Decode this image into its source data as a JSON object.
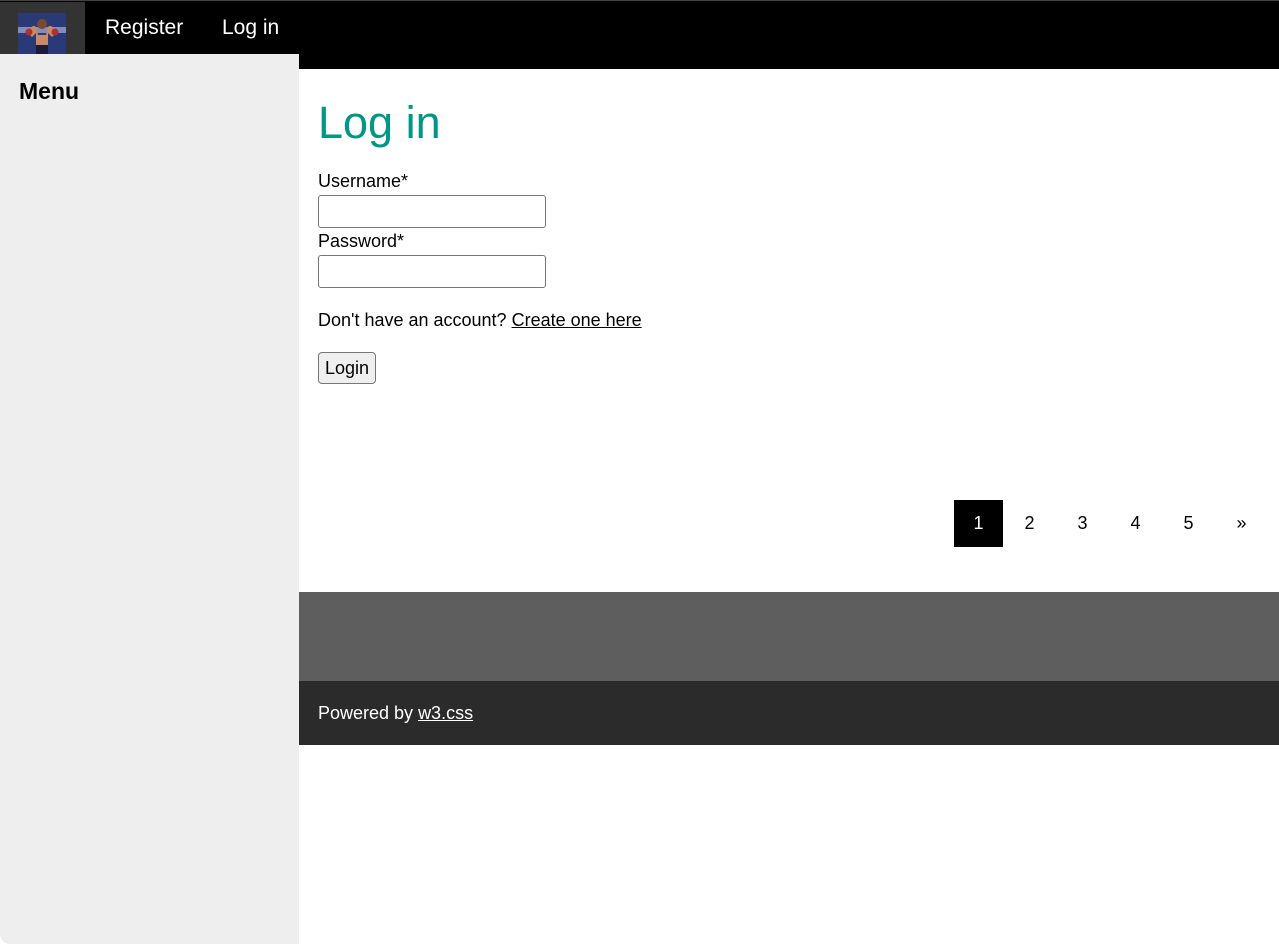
{
  "topnav": {
    "logo_icon": "boxer-avatar-icon",
    "register_label": "Register",
    "login_label": "Log in"
  },
  "sidebar": {
    "title": "Menu"
  },
  "main": {
    "title": "Log in",
    "form": {
      "username_label": "Username*",
      "username_value": "",
      "password_label": "Password*",
      "password_value": "",
      "no_account_text": "Don't have an account? ",
      "create_link": "Create one here",
      "submit_label": "Login"
    },
    "pagination": {
      "pages": [
        "1",
        "2",
        "3",
        "4",
        "5"
      ],
      "active_page": "1",
      "next_label": "»"
    }
  },
  "footer": {
    "powered_text": "Powered by ",
    "powered_link": "w3.css"
  },
  "colors": {
    "accent": "#009688",
    "topbar": "#000000",
    "sidebar": "#eeeeee",
    "footer_top": "#5e5e5e",
    "footer_bottom": "#2b2b2b"
  }
}
